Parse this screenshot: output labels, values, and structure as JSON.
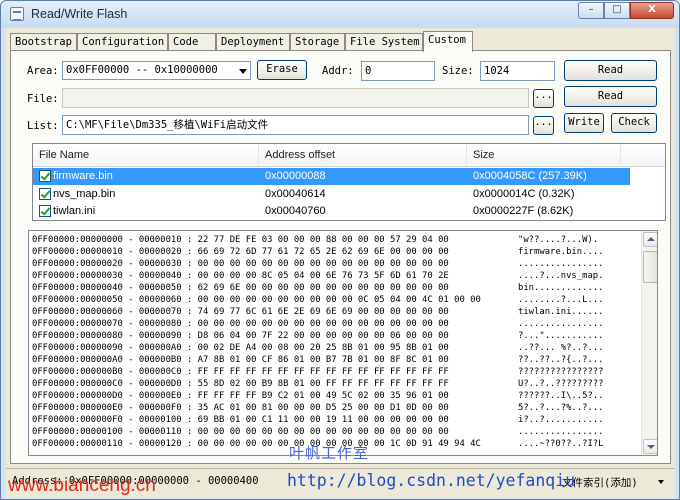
{
  "window": {
    "title": "Read/Write Flash"
  },
  "titlebar_buttons": {
    "minimize": "–",
    "maximize": "□",
    "close": "X"
  },
  "tabs": [
    {
      "label": "Bootstrap"
    },
    {
      "label": "Configuration"
    },
    {
      "label": "Code"
    },
    {
      "label": "Deployment"
    },
    {
      "label": "Storage"
    },
    {
      "label": "File System"
    },
    {
      "label": "Custom"
    }
  ],
  "active_tab": "Custom",
  "form": {
    "area_label": "Area:",
    "area_value": "0x0FF00000 -- 0x10000000",
    "erase_button": "Erase",
    "addr_label": "Addr:",
    "addr_value": "0",
    "size_label": "Size:",
    "size_value": "1024",
    "read_button": "Read",
    "file_label": "File:",
    "file_value": "",
    "file_browse": "...",
    "read_button_2": "Read",
    "list_label": "List:",
    "list_value": "C:\\MF\\File\\Dm335_移植\\WiFi启动文件",
    "list_browse": "...",
    "write_button": "Write",
    "check_button": "Check"
  },
  "file_list": {
    "columns": [
      "File Name",
      "Address offset",
      "Size"
    ],
    "rows": [
      {
        "name": "firmware.bin",
        "offset": "0x00000088",
        "size": "0x0004058C (257.39K)",
        "checked": true,
        "selected": true
      },
      {
        "name": "nvs_map.bin",
        "offset": "0x00040614",
        "size": "0x0000014C (0.32K)",
        "checked": true,
        "selected": false
      },
      {
        "name": "tiwlan.ini",
        "offset": "0x00040760",
        "size": "0x0000227F (8.62K)",
        "checked": true,
        "selected": false
      }
    ]
  },
  "hex_dump": [
    {
      "range": "0FF00000:00000000 - 00000010 :",
      "bytes": "22 77 DE FE 03 00 00 00 88 00 00 00 57 29 04 00",
      "ascii": "\"w??....?...W)."
    },
    {
      "range": "0FF00000:00000010 - 00000020 :",
      "bytes": "66 69 72 6D 77 61 72 65 2E 62 69 6E 00 00 00 00",
      "ascii": "firmware.bin...."
    },
    {
      "range": "0FF00000:00000020 - 00000030 :",
      "bytes": "00 00 00 00 00 00 00 00 00 00 00 00 00 00 00 00",
      "ascii": "................"
    },
    {
      "range": "0FF00000:00000030 - 00000040 :",
      "bytes": "00 00 00 00 8C 05 04 00 6E 76 73 5F 6D 61 70 2E",
      "ascii": "....?...nvs_map."
    },
    {
      "range": "0FF00000:00000040 - 00000050 :",
      "bytes": "62 69 6E 00 00 00 00 00 00 00 00 00 00 00 00 00",
      "ascii": "bin............."
    },
    {
      "range": "0FF00000:00000050 - 00000060 :",
      "bytes": "00 00 00 00 00 00 00 00 00 00 0C 05 04 00 4C 01 00 00",
      "ascii": "........?...L..."
    },
    {
      "range": "0FF00000:00000060 - 00000070 :",
      "bytes": "74 69 77 6C 61 6E 2E 69 6E 69 00 00 00 00 00 00",
      "ascii": "tiwlan.ini......"
    },
    {
      "range": "0FF00000:00000070 - 00000080 :",
      "bytes": "00 00 00 00 00 00 00 00 00 00 00 00 00 00 00 00",
      "ascii": "................"
    },
    {
      "range": "0FF00000:00000080 - 00000090 :",
      "bytes": "D8 06 04 00 7F 22 00 00 00 00 00 00 06 00 00 00",
      "ascii": "?...\"..........."
    },
    {
      "range": "0FF00000:00000090 - 000000A0 :",
      "bytes": "00 02 DE A4 00 08 00 20 25 8B 01 00 95 8B 01 00",
      "ascii": "..??... %?..?..."
    },
    {
      "range": "0FF00000:000000A0 - 000000B0 :",
      "bytes": "A7 8B 01 00 CF 86 01 00 B7 7B 01 00 8F 8C 01 00",
      "ascii": "??..??..?{..?..."
    },
    {
      "range": "0FF00000:000000B0 - 000000C0 :",
      "bytes": "FF FF FF FF FF FF FF FF FF FF FF FF FF FF FF FF",
      "ascii": "????????????????"
    },
    {
      "range": "0FF00000:000000C0 - 000000D0 :",
      "bytes": "55 8D 02 00 B9 8B 01 00 FF FF FF FF FF FF FF FF",
      "ascii": "U?..?..?????????"
    },
    {
      "range": "0FF00000:000000D0 - 000000E0 :",
      "bytes": "FF FF FF FF B9 C2 01 00 49 5C 02 00 35 96 01 00",
      "ascii": "??????..I\\..5?.."
    },
    {
      "range": "0FF00000:000000E0 - 000000F0 :",
      "bytes": "35 AC 01 00 81 00 00 00 D5 25 00 00 D1 0D 00 00",
      "ascii": "5?..?...?%..?..."
    },
    {
      "range": "0FF00000:000000F0 - 00000100 :",
      "bytes": "69 BB 01 00 C1 11 00 00 19 11 00 00 00 00 00 00",
      "ascii": "i?..?..........."
    },
    {
      "range": "0FF00000:00000100 - 00000110 :",
      "bytes": "00 00 00 00 00 00 00 00 00 00 00 00 00 00 00 00",
      "ascii": "................"
    },
    {
      "range": "0FF00000:00000110 - 00000120 :",
      "bytes": "00 00 00 00 00 00 00 00 00 00 00 00 1C 0D 91 49 94 4C",
      "ascii": "....~??0??..?I?L"
    }
  ],
  "status": {
    "address_text": "Address: 0x0FF00000:00000000 - 00000400",
    "index_text": "文件索引(添加)"
  },
  "watermarks": {
    "site": "www.bianceng.cn",
    "studio": "叶帆工作室",
    "blog": "http://blog.csdn.net/yefanqiu"
  }
}
